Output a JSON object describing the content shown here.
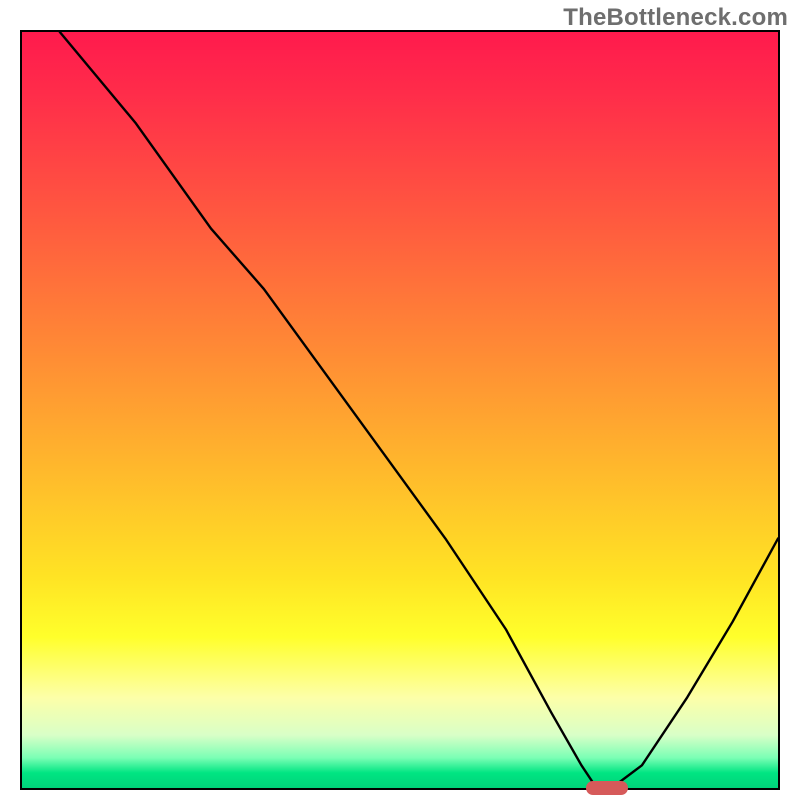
{
  "watermark": "TheBottleneck.com",
  "chart_data": {
    "type": "line",
    "title": "",
    "xlabel": "",
    "ylabel": "",
    "xlim": [
      0,
      100
    ],
    "ylim": [
      0,
      100
    ],
    "grid": false,
    "legend": false,
    "series": [
      {
        "name": "bottleneck-curve",
        "x": [
          5,
          15,
          25,
          32,
          40,
          48,
          56,
          64,
          70,
          74,
          76,
          78,
          82,
          88,
          94,
          100
        ],
        "y": [
          100,
          88,
          74,
          66,
          55,
          44,
          33,
          21,
          10,
          3,
          0,
          0,
          3,
          12,
          22,
          33
        ]
      }
    ],
    "marker": {
      "x": 77,
      "width_pct": 5.5,
      "color": "#d65a5a"
    },
    "gradient_stops": [
      {
        "pct": 0,
        "color": "#ff1a4d"
      },
      {
        "pct": 25,
        "color": "#ff5a3f"
      },
      {
        "pct": 50,
        "color": "#ffb92c"
      },
      {
        "pct": 80,
        "color": "#ffff2b"
      },
      {
        "pct": 96,
        "color": "#7bffb5"
      },
      {
        "pct": 100,
        "color": "#00d27a"
      }
    ]
  }
}
